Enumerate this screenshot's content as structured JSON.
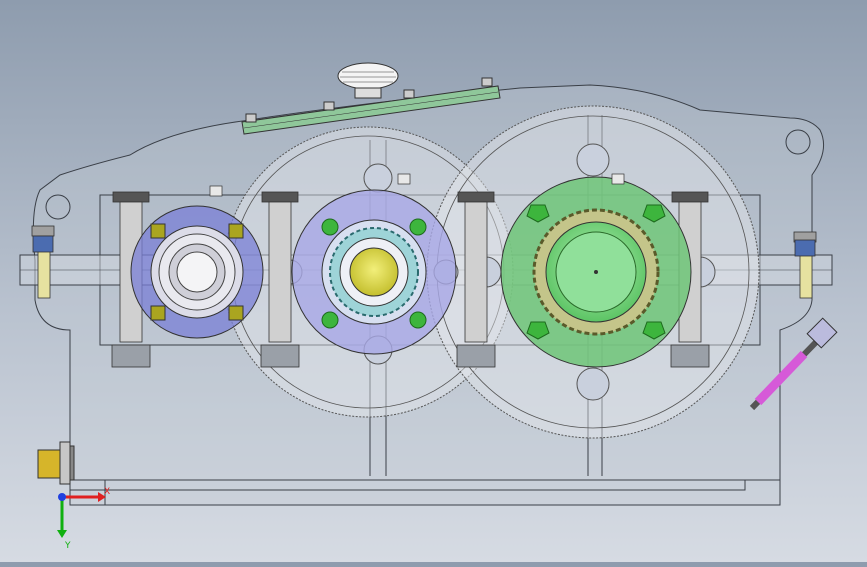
{
  "viewport": {
    "description": "",
    "background_top": "#8e9cae",
    "background_bottom": "#d6dbe3"
  },
  "colors": {
    "housing_line": "#3a3f47",
    "housing_fill": "#c9cfd8",
    "left_flange": "#7a7fd6",
    "middle_flange": "#a7a8e6",
    "right_flange": "#7fd28a",
    "bolt_green": "#3db53d",
    "center_yellow": "#d6d247",
    "dipstick": "#d65ad8",
    "axis_x": "#e02020",
    "axis_y": "#10b010"
  },
  "triad": {
    "x_label": "X",
    "y_label": "Y"
  },
  "icons": {
    "breather": "breather-cap-icon",
    "drain_plug": "drain-plug-icon",
    "triad": "coordinate-triad-icon"
  }
}
